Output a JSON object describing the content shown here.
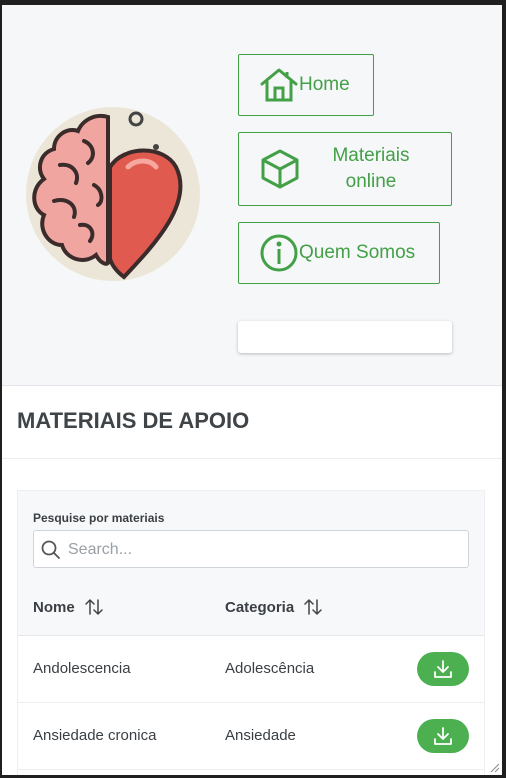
{
  "nav": {
    "home_label": "Home",
    "materials_label": "Materiais\nonline",
    "about_label": "Quem Somos"
  },
  "page": {
    "title": "MATERIAIS DE APOIO"
  },
  "search": {
    "label": "Pesquise por materiais",
    "placeholder": "Search...",
    "value": ""
  },
  "table": {
    "columns": [
      "Nome",
      "Categoria"
    ],
    "rows": [
      {
        "name": "Andolescencia",
        "category": "Adolescência"
      },
      {
        "name": "Ansiedade cronica",
        "category": "Ansiedade"
      }
    ]
  },
  "icons": {
    "nav_home": "house-icon",
    "nav_materials": "box-icon",
    "nav_about": "info-icon",
    "search": "search-icon",
    "sort": "sort-icon",
    "download": "download-icon"
  },
  "colors": {
    "accent": "#43a047",
    "button": "#4caf50",
    "title": "#3f4448"
  }
}
